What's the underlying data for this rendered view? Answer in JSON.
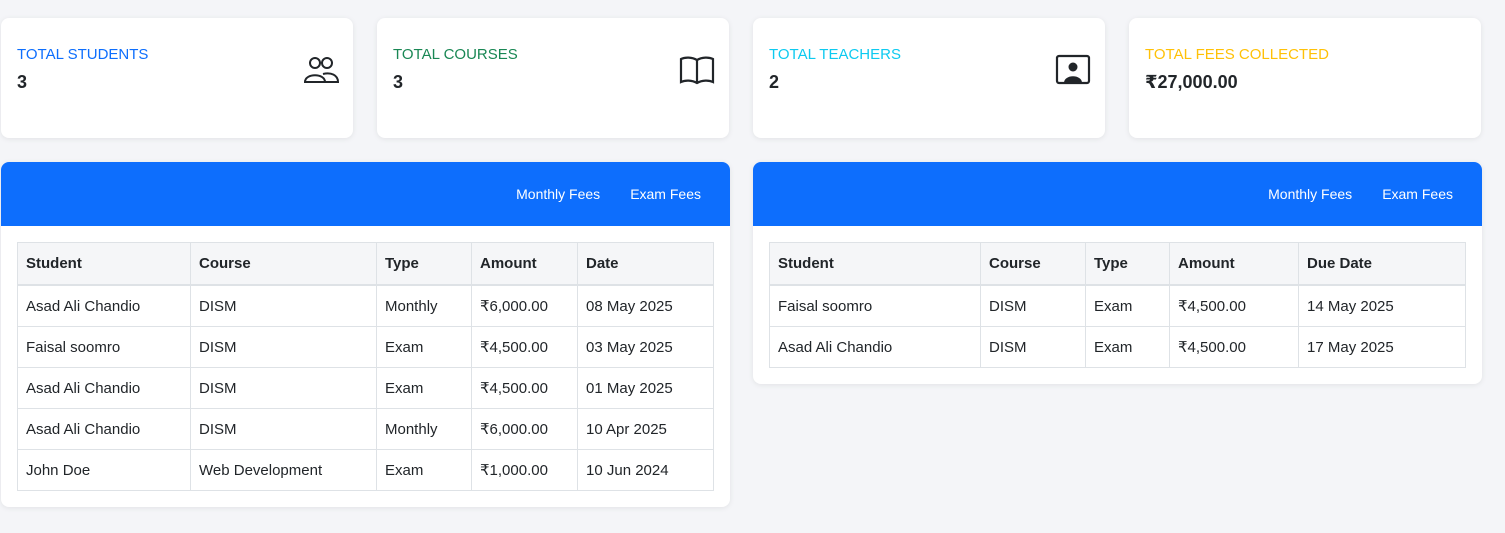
{
  "stats": [
    {
      "label": "TOTAL STUDENTS",
      "value": "3",
      "color": "#0d6efd",
      "icon": "people-icon"
    },
    {
      "label": "TOTAL COURSES",
      "value": "3",
      "color": "#198754",
      "icon": "book-icon"
    },
    {
      "label": "TOTAL TEACHERS",
      "value": "2",
      "color": "#0dcaf0",
      "icon": "teacher-icon"
    },
    {
      "label": "TOTAL FEES COLLECTED",
      "value": "₹27,000.00",
      "color": "#ffc107",
      "icon": ""
    }
  ],
  "recent_panel": {
    "tabs": [
      "Monthly Fees",
      "Exam Fees"
    ],
    "columns": [
      "Student",
      "Course",
      "Type",
      "Amount",
      "Date"
    ],
    "rows": [
      [
        "Asad Ali Chandio",
        "DISM",
        "Monthly",
        "₹6,000.00",
        "08 May 2025"
      ],
      [
        "Faisal soomro",
        "DISM",
        "Exam",
        "₹4,500.00",
        "03 May 2025"
      ],
      [
        "Asad Ali Chandio",
        "DISM",
        "Exam",
        "₹4,500.00",
        "01 May 2025"
      ],
      [
        "Asad Ali Chandio",
        "DISM",
        "Monthly",
        "₹6,000.00",
        "10 Apr 2025"
      ],
      [
        "John Doe",
        "Web Development",
        "Exam",
        "₹1,000.00",
        "10 Jun 2024"
      ]
    ]
  },
  "due_panel": {
    "tabs": [
      "Monthly Fees",
      "Exam Fees"
    ],
    "columns": [
      "Student",
      "Course",
      "Type",
      "Amount",
      "Due Date"
    ],
    "rows": [
      [
        "Faisal soomro",
        "DISM",
        "Exam",
        "₹4,500.00",
        "14 May 2025"
      ],
      [
        "Asad Ali Chandio",
        "DISM",
        "Exam",
        "₹4,500.00",
        "17 May 2025"
      ]
    ]
  },
  "colors": {
    "accent": "#0d6efd"
  }
}
